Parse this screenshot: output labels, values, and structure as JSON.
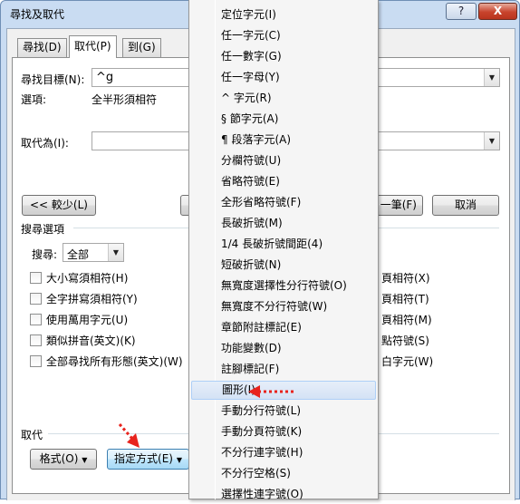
{
  "window": {
    "title": "尋找及取代",
    "help": "?",
    "close": "X"
  },
  "tabs": [
    {
      "label": "尋找(D)"
    },
    {
      "label": "取代(P)"
    },
    {
      "label": "到(G)"
    }
  ],
  "find": {
    "label": "尋找目標(N):",
    "value": "^g"
  },
  "options": {
    "label": "選項:",
    "value": "全半形須相符"
  },
  "replace": {
    "label": "取代為(I):",
    "value": ""
  },
  "buttons": {
    "less": "<< 較少(L)",
    "replace_all": "一筆(F)",
    "cancel": "取消"
  },
  "search_options": {
    "title": "搜尋選項",
    "direction_label": "搜尋:",
    "direction_value": "全部",
    "left_checks": [
      "大小寫須相符(H)",
      "全字拼寫須相符(Y)",
      "使用萬用字元(U)",
      "類似拼音(英文)(K)",
      "全部尋找所有形態(英文)(W)"
    ],
    "right_checks": [
      "頁相符(X)",
      "頁相符(T)",
      "頁相符(M)",
      "點符號(S)",
      "白字元(W)"
    ]
  },
  "replace_section": {
    "title": "取代",
    "format": "格式(O)",
    "special": "指定方式(E)"
  },
  "menu": {
    "items": [
      "定位字元(I)",
      "任一字元(C)",
      "任一數字(G)",
      "任一字母(Y)",
      "^ 字元(R)",
      "§ 節字元(A)",
      "¶ 段落字元(A)",
      "分欄符號(U)",
      "省略符號(E)",
      "全形省略符號(F)",
      "長破折號(M)",
      "1/4 長破折號間距(4)",
      "短破折號(N)",
      "無寬度選擇性分行符號(O)",
      "無寬度不分行符號(W)",
      "章節附註標記(E)",
      "功能變數(D)",
      "註腳標記(F)",
      "圖形(I)",
      "手動分行符號(L)",
      "手動分頁符號(K)",
      "不分行連字號(H)",
      "不分行空格(S)",
      "選擇性連字號(O)"
    ],
    "highlighted_index": 18
  },
  "colors": {
    "annotation_arrow": "#e8231d",
    "highlight": "#d4e2f5"
  }
}
